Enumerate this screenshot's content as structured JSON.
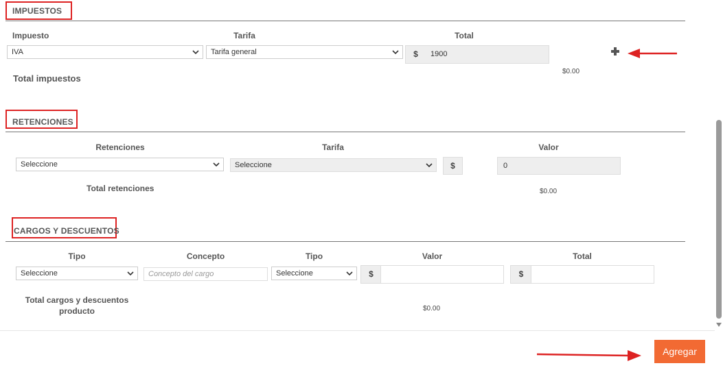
{
  "impuestos": {
    "title": "IMPUESTOS",
    "headers": {
      "impuesto": "Impuesto",
      "tarifa": "Tarifa",
      "total": "Total"
    },
    "impuesto_value": "IVA",
    "tarifa_value": "Tarifa general",
    "currency": "$",
    "total_value": "1900",
    "add_icon": "plus-icon",
    "total_label": "Total impuestos",
    "total_amount": "$0.00"
  },
  "retenciones": {
    "title": "RETENCIONES",
    "headers": {
      "retenciones": "Retenciones",
      "tarifa": "Tarifa",
      "valor": "Valor"
    },
    "retencion_value": "Seleccione",
    "tarifa_value": "Seleccione",
    "currency": "$",
    "valor_value": "0",
    "total_label": "Total retenciones",
    "total_amount": "$0.00"
  },
  "cargos": {
    "title": "CARGOS Y DESCUENTOS",
    "headers": {
      "tipo": "Tipo",
      "concepto": "Concepto",
      "tipo2": "Tipo",
      "valor": "Valor",
      "total": "Total"
    },
    "tipo_value": "Seleccione",
    "concepto_placeholder": "Concepto del cargo",
    "tipo2_value": "Seleccione",
    "currency_valor": "$",
    "currency_total": "$",
    "total_label_line1": "Total cargos y descuentos",
    "total_label_line2": "producto",
    "total_amount": "$0.00"
  },
  "footer": {
    "add_button": "Agregar"
  },
  "colors": {
    "accent": "#f26a33",
    "annotation": "#dd2222"
  }
}
